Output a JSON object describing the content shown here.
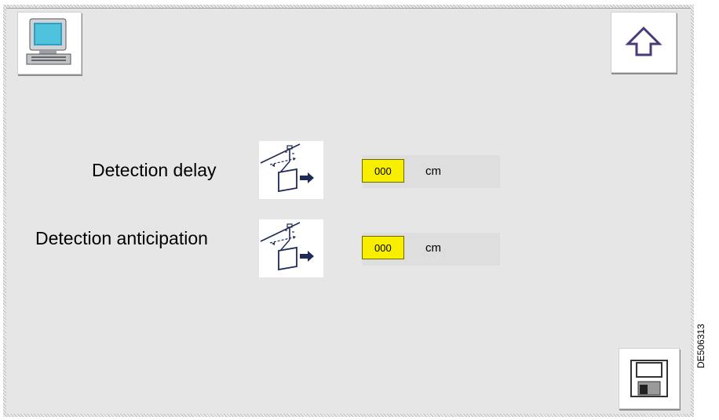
{
  "rows": [
    {
      "label": "Detection delay",
      "icon": "detection-delay-icon",
      "value": "000",
      "unit": "cm"
    },
    {
      "label": "Detection anticipation",
      "icon": "detection-anticipation-icon",
      "value": "000",
      "unit": "cm"
    }
  ],
  "buttons": {
    "computer": "computer-monitor-icon",
    "up": "up-arrow-icon",
    "save": "floppy-disk-icon"
  },
  "doc_code": "DE506313",
  "colors": {
    "panel_bg": "#e6e6e6",
    "value_bg": "#f7ee00",
    "arrow_stroke": "#4a3a7a"
  }
}
